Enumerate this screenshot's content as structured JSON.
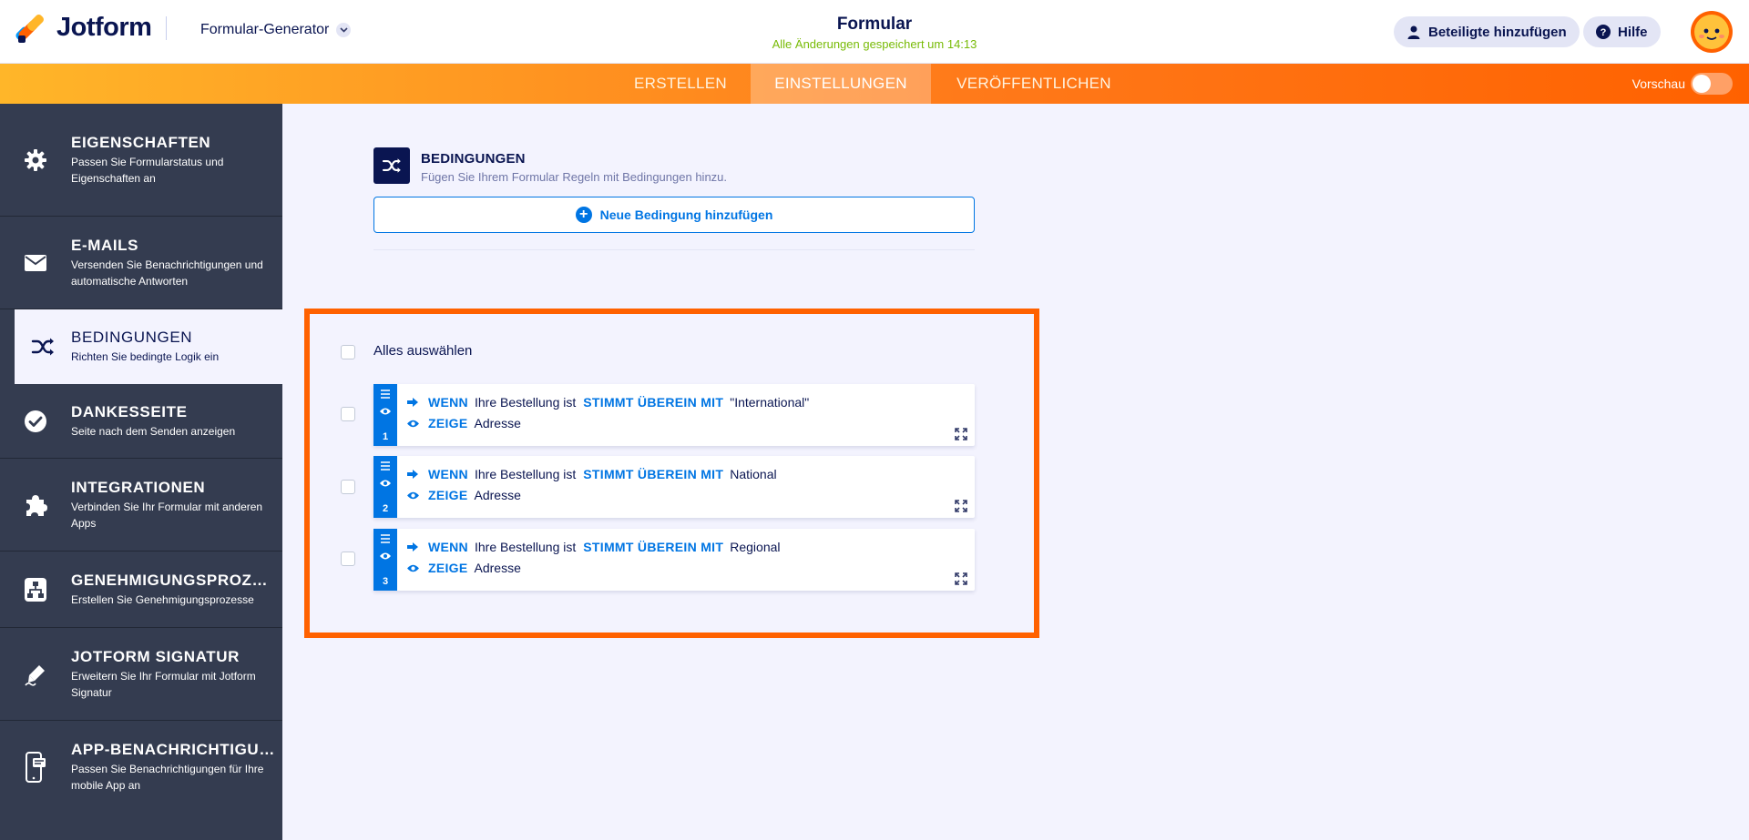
{
  "header": {
    "logo_text": "Jotform",
    "generator_label": "Formular-Generator",
    "form_title": "Formular",
    "saved_status": "Alle Änderungen gespeichert um 14:13",
    "add_participants_label": "Beteiligte hinzufügen",
    "help_label": "Hilfe"
  },
  "nav": {
    "tabs": [
      {
        "label": "ERSTELLEN"
      },
      {
        "label": "EINSTELLUNGEN",
        "active": true
      },
      {
        "label": "VERÖFFENTLICHEN"
      }
    ],
    "preview_label": "Vorschau",
    "preview_on": false
  },
  "sidebar": {
    "items": [
      {
        "title": "EIGENSCHAFTEN",
        "desc": "Passen Sie Formularstatus und Eigenschaften an",
        "icon": "gear-icon"
      },
      {
        "title": "E-MAILS",
        "desc": "Versenden Sie Benachrichtigungen und automatische Antworten",
        "icon": "envelope-icon"
      },
      {
        "title": "BEDINGUNGEN",
        "desc": "Richten Sie bedingte Logik ein",
        "icon": "shuffle-icon",
        "active": true
      },
      {
        "title": "DANKESSEITE",
        "desc": "Seite nach dem Senden anzeigen",
        "icon": "check-circle-icon"
      },
      {
        "title": "INTEGRATIONEN",
        "desc": "Verbinden Sie Ihr Formular mit anderen Apps",
        "icon": "puzzle-icon"
      },
      {
        "title": "GENEHMIGUNGSPROZESSE",
        "desc": "Erstellen Sie Genehmigungsprozesse",
        "icon": "flow-icon"
      },
      {
        "title": "JOTFORM SIGNATUR",
        "desc": "Erweitern Sie Ihr Formular mit Jotform Signatur",
        "icon": "pen-icon"
      },
      {
        "title": "APP-BENACHRICHTIGUNG",
        "desc": "Passen Sie Benachrichtigungen für Ihre mobile App an",
        "icon": "mobile-icon"
      }
    ]
  },
  "conditions": {
    "title": "BEDINGUNGEN",
    "subtitle": "Fügen Sie Ihrem Formular Regeln mit Bedingungen hinzu.",
    "add_button_label": "Neue Bedingung hinzufügen",
    "select_all_label": "Alles auswählen",
    "rules": [
      {
        "index": "1",
        "if_kw": "WENN",
        "field": "Ihre Bestellung ist",
        "operator": "STIMMT ÜBEREIN MIT",
        "value": "\"International\"",
        "then_kw": "ZEIGE",
        "target": "Adresse"
      },
      {
        "index": "2",
        "if_kw": "WENN",
        "field": "Ihre Bestellung ist",
        "operator": "STIMMT ÜBEREIN MIT",
        "value": "National",
        "then_kw": "ZEIGE",
        "target": "Adresse"
      },
      {
        "index": "3",
        "if_kw": "WENN",
        "field": "Ihre Bestellung ist",
        "operator": "STIMMT ÜBEREIN MIT",
        "value": "Regional",
        "then_kw": "ZEIGE",
        "target": "Adresse"
      }
    ]
  },
  "colors": {
    "accent_blue": "#0075e3",
    "brand_orange": "#ff6100",
    "navy": "#0a1551",
    "sidebar_bg": "#343c50",
    "saved_green": "#78bb07"
  }
}
